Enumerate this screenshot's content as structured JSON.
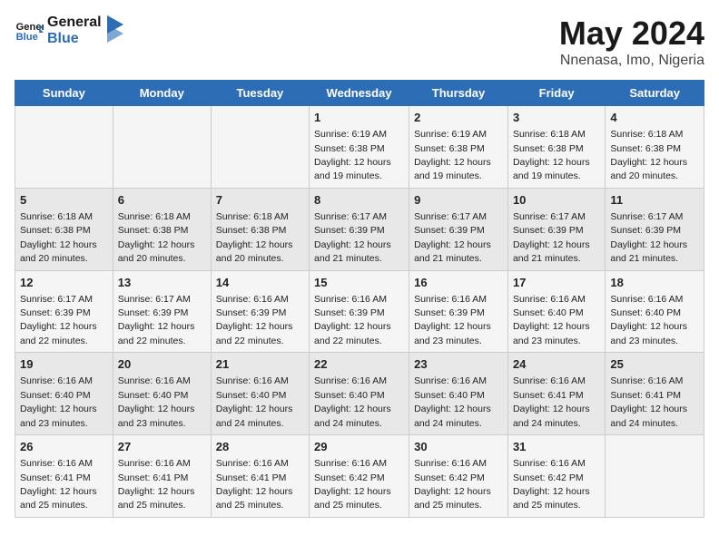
{
  "logo": {
    "line1": "General",
    "line2": "Blue"
  },
  "title": "May 2024",
  "subtitle": "Nnenasa, Imo, Nigeria",
  "days_header": [
    "Sunday",
    "Monday",
    "Tuesday",
    "Wednesday",
    "Thursday",
    "Friday",
    "Saturday"
  ],
  "weeks": [
    [
      {
        "day": "",
        "sunrise": "",
        "sunset": "",
        "daylight": ""
      },
      {
        "day": "",
        "sunrise": "",
        "sunset": "",
        "daylight": ""
      },
      {
        "day": "",
        "sunrise": "",
        "sunset": "",
        "daylight": ""
      },
      {
        "day": "1",
        "sunrise": "Sunrise: 6:19 AM",
        "sunset": "Sunset: 6:38 PM",
        "daylight": "Daylight: 12 hours and 19 minutes."
      },
      {
        "day": "2",
        "sunrise": "Sunrise: 6:19 AM",
        "sunset": "Sunset: 6:38 PM",
        "daylight": "Daylight: 12 hours and 19 minutes."
      },
      {
        "day": "3",
        "sunrise": "Sunrise: 6:18 AM",
        "sunset": "Sunset: 6:38 PM",
        "daylight": "Daylight: 12 hours and 19 minutes."
      },
      {
        "day": "4",
        "sunrise": "Sunrise: 6:18 AM",
        "sunset": "Sunset: 6:38 PM",
        "daylight": "Daylight: 12 hours and 20 minutes."
      }
    ],
    [
      {
        "day": "5",
        "sunrise": "Sunrise: 6:18 AM",
        "sunset": "Sunset: 6:38 PM",
        "daylight": "Daylight: 12 hours and 20 minutes."
      },
      {
        "day": "6",
        "sunrise": "Sunrise: 6:18 AM",
        "sunset": "Sunset: 6:38 PM",
        "daylight": "Daylight: 12 hours and 20 minutes."
      },
      {
        "day": "7",
        "sunrise": "Sunrise: 6:18 AM",
        "sunset": "Sunset: 6:38 PM",
        "daylight": "Daylight: 12 hours and 20 minutes."
      },
      {
        "day": "8",
        "sunrise": "Sunrise: 6:17 AM",
        "sunset": "Sunset: 6:39 PM",
        "daylight": "Daylight: 12 hours and 21 minutes."
      },
      {
        "day": "9",
        "sunrise": "Sunrise: 6:17 AM",
        "sunset": "Sunset: 6:39 PM",
        "daylight": "Daylight: 12 hours and 21 minutes."
      },
      {
        "day": "10",
        "sunrise": "Sunrise: 6:17 AM",
        "sunset": "Sunset: 6:39 PM",
        "daylight": "Daylight: 12 hours and 21 minutes."
      },
      {
        "day": "11",
        "sunrise": "Sunrise: 6:17 AM",
        "sunset": "Sunset: 6:39 PM",
        "daylight": "Daylight: 12 hours and 21 minutes."
      }
    ],
    [
      {
        "day": "12",
        "sunrise": "Sunrise: 6:17 AM",
        "sunset": "Sunset: 6:39 PM",
        "daylight": "Daylight: 12 hours and 22 minutes."
      },
      {
        "day": "13",
        "sunrise": "Sunrise: 6:17 AM",
        "sunset": "Sunset: 6:39 PM",
        "daylight": "Daylight: 12 hours and 22 minutes."
      },
      {
        "day": "14",
        "sunrise": "Sunrise: 6:16 AM",
        "sunset": "Sunset: 6:39 PM",
        "daylight": "Daylight: 12 hours and 22 minutes."
      },
      {
        "day": "15",
        "sunrise": "Sunrise: 6:16 AM",
        "sunset": "Sunset: 6:39 PM",
        "daylight": "Daylight: 12 hours and 22 minutes."
      },
      {
        "day": "16",
        "sunrise": "Sunrise: 6:16 AM",
        "sunset": "Sunset: 6:39 PM",
        "daylight": "Daylight: 12 hours and 23 minutes."
      },
      {
        "day": "17",
        "sunrise": "Sunrise: 6:16 AM",
        "sunset": "Sunset: 6:40 PM",
        "daylight": "Daylight: 12 hours and 23 minutes."
      },
      {
        "day": "18",
        "sunrise": "Sunrise: 6:16 AM",
        "sunset": "Sunset: 6:40 PM",
        "daylight": "Daylight: 12 hours and 23 minutes."
      }
    ],
    [
      {
        "day": "19",
        "sunrise": "Sunrise: 6:16 AM",
        "sunset": "Sunset: 6:40 PM",
        "daylight": "Daylight: 12 hours and 23 minutes."
      },
      {
        "day": "20",
        "sunrise": "Sunrise: 6:16 AM",
        "sunset": "Sunset: 6:40 PM",
        "daylight": "Daylight: 12 hours and 23 minutes."
      },
      {
        "day": "21",
        "sunrise": "Sunrise: 6:16 AM",
        "sunset": "Sunset: 6:40 PM",
        "daylight": "Daylight: 12 hours and 24 minutes."
      },
      {
        "day": "22",
        "sunrise": "Sunrise: 6:16 AM",
        "sunset": "Sunset: 6:40 PM",
        "daylight": "Daylight: 12 hours and 24 minutes."
      },
      {
        "day": "23",
        "sunrise": "Sunrise: 6:16 AM",
        "sunset": "Sunset: 6:40 PM",
        "daylight": "Daylight: 12 hours and 24 minutes."
      },
      {
        "day": "24",
        "sunrise": "Sunrise: 6:16 AM",
        "sunset": "Sunset: 6:41 PM",
        "daylight": "Daylight: 12 hours and 24 minutes."
      },
      {
        "day": "25",
        "sunrise": "Sunrise: 6:16 AM",
        "sunset": "Sunset: 6:41 PM",
        "daylight": "Daylight: 12 hours and 24 minutes."
      }
    ],
    [
      {
        "day": "26",
        "sunrise": "Sunrise: 6:16 AM",
        "sunset": "Sunset: 6:41 PM",
        "daylight": "Daylight: 12 hours and 25 minutes."
      },
      {
        "day": "27",
        "sunrise": "Sunrise: 6:16 AM",
        "sunset": "Sunset: 6:41 PM",
        "daylight": "Daylight: 12 hours and 25 minutes."
      },
      {
        "day": "28",
        "sunrise": "Sunrise: 6:16 AM",
        "sunset": "Sunset: 6:41 PM",
        "daylight": "Daylight: 12 hours and 25 minutes."
      },
      {
        "day": "29",
        "sunrise": "Sunrise: 6:16 AM",
        "sunset": "Sunset: 6:42 PM",
        "daylight": "Daylight: 12 hours and 25 minutes."
      },
      {
        "day": "30",
        "sunrise": "Sunrise: 6:16 AM",
        "sunset": "Sunset: 6:42 PM",
        "daylight": "Daylight: 12 hours and 25 minutes."
      },
      {
        "day": "31",
        "sunrise": "Sunrise: 6:16 AM",
        "sunset": "Sunset: 6:42 PM",
        "daylight": "Daylight: 12 hours and 25 minutes."
      },
      {
        "day": "",
        "sunrise": "",
        "sunset": "",
        "daylight": ""
      }
    ]
  ]
}
